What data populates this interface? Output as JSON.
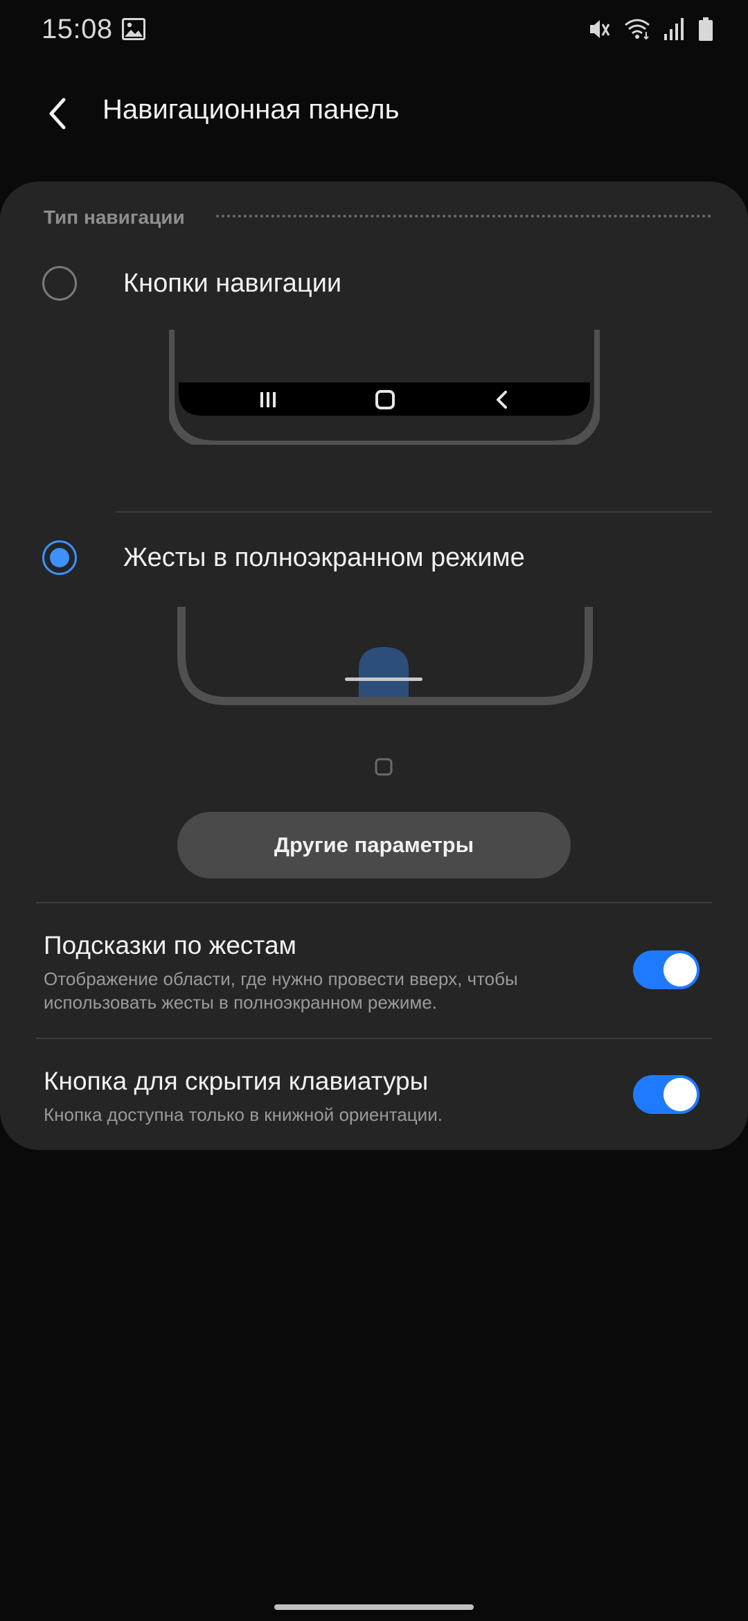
{
  "status_bar": {
    "time": "15:08",
    "icons": [
      "gallery-icon",
      "mute-icon",
      "wifi-icon",
      "signal-icon",
      "battery-icon"
    ]
  },
  "header": {
    "title": "Навигационная панель",
    "back_icon": "back-arrow-icon"
  },
  "section": {
    "title": "Тип навигации"
  },
  "options": [
    {
      "label": "Кнопки навигации",
      "selected": false
    },
    {
      "label": "Жесты в полноэкранном режиме",
      "selected": true
    }
  ],
  "other_params_button": "Другие параметры",
  "switches": [
    {
      "title": "Подсказки по жестам",
      "description": "Отображение области, где нужно провести вверх, чтобы использовать жесты в полноэкранном режиме.",
      "enabled": true
    },
    {
      "title": "Кнопка для скрытия клавиатуры",
      "description": "Кнопка доступна только в книжной ориентации.",
      "enabled": true
    }
  ],
  "colors": {
    "accent": "#1e7bff",
    "radio_selected": "#3e91ff",
    "background": "#0a0a0a",
    "card": "#252525"
  }
}
